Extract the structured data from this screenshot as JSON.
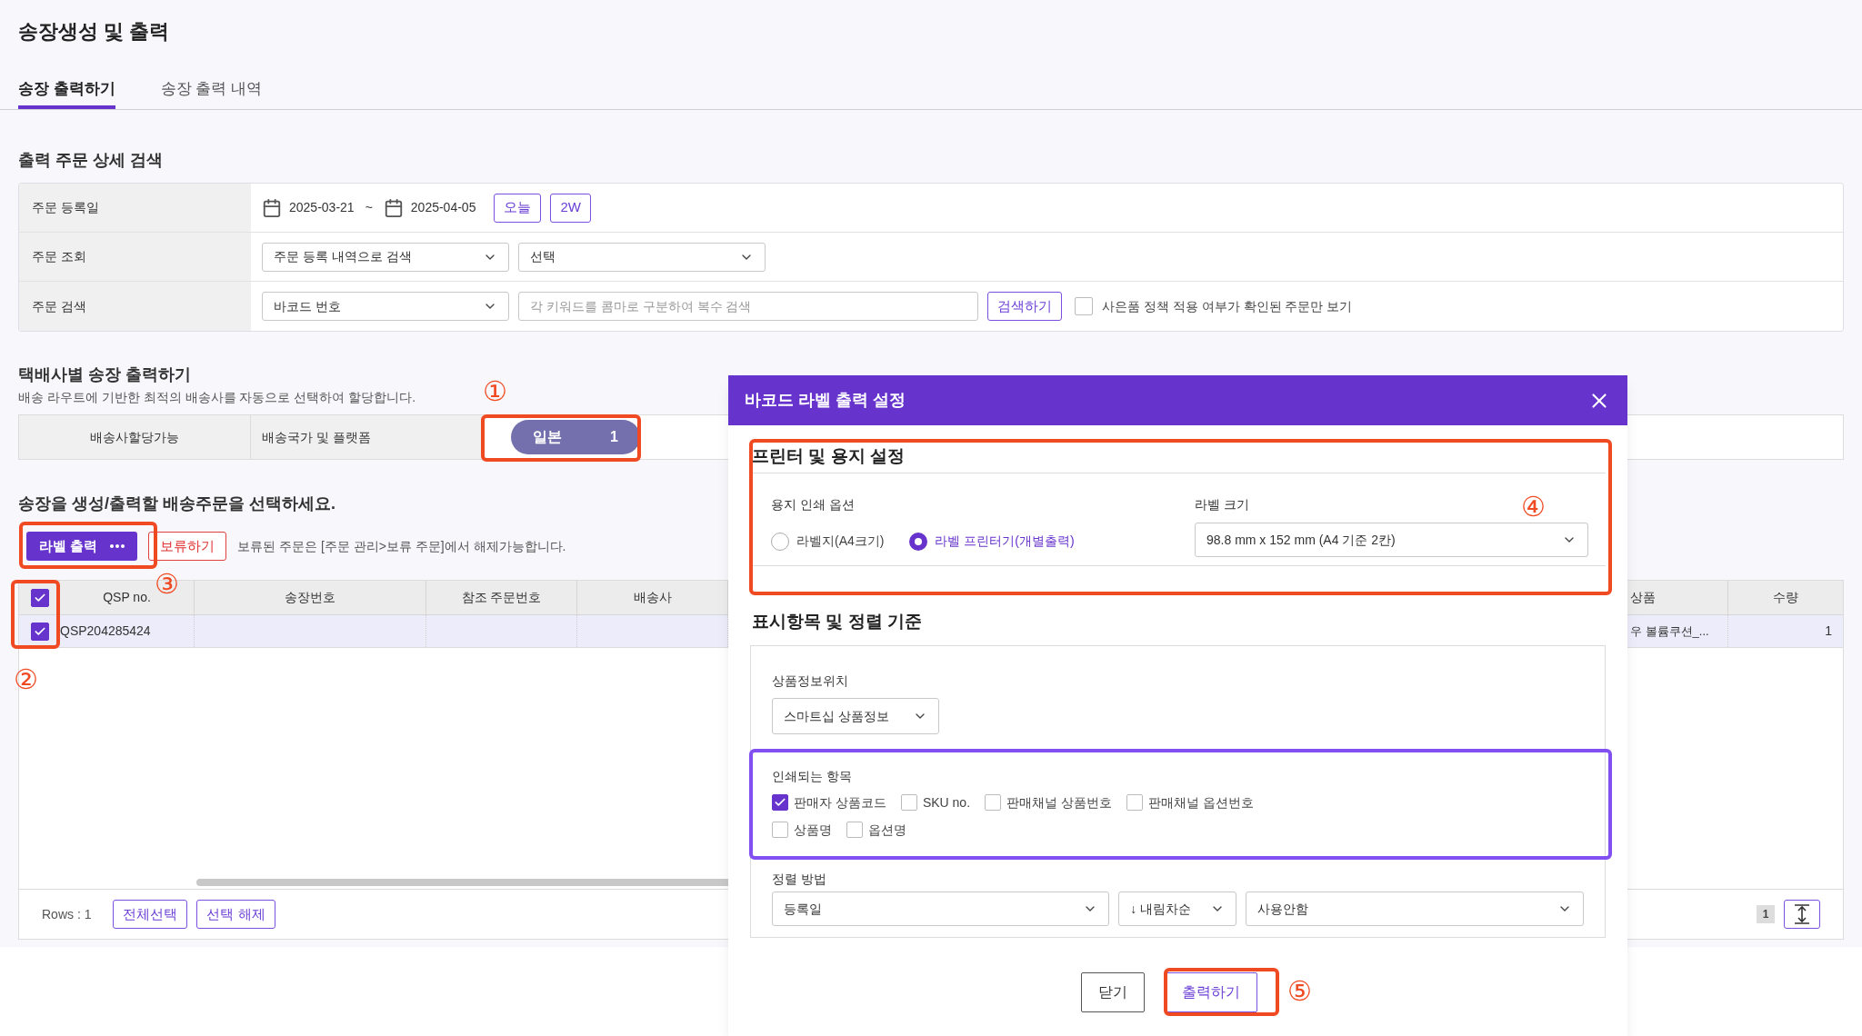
{
  "page_title": "송장생성 및 출력",
  "tabs": [
    {
      "label": "송장 출력하기",
      "selected": true
    },
    {
      "label": "송장 출력 내역",
      "selected": false
    }
  ],
  "search": {
    "title": "출력 주문 상세 검색",
    "date_row": {
      "label": "주문 등록일",
      "start": "2025-03-21",
      "separator": "~",
      "end": "2025-04-05",
      "buttons": [
        "오늘",
        "2W"
      ]
    },
    "query_row": {
      "label": "주문 조회",
      "selects": [
        "주문 등록 내역으로 검색",
        "선택"
      ]
    },
    "keyword_row": {
      "label": "주문 검색",
      "select": "바코드 번호",
      "placeholder": "각 키워드를 콤마로 구분하여 복수 검색",
      "button": "검색하기",
      "filter": {
        "label": "사은품 정책 적용 여부가 확인된 주문만 보기",
        "checked": false
      }
    }
  },
  "carrier": {
    "title": "택배사별 송장 출력하기",
    "subtitle": "배송 라우트에 기반한 최적의 배송사를 자동으로 선택하여 할당합니다.",
    "cells": [
      "배송사할당가능",
      "배송국가 및 플랫폼"
    ],
    "pill": {
      "label": "일본",
      "count": "1"
    }
  },
  "orders": {
    "title": "송장을 생성/출력할 배송주문을 선택하세요.",
    "print_button": "라벨 출력",
    "hold_button": "보류하기",
    "hold_note": "보류된 주문은 [주문 관리>보류 주문]에서 해제가능합니다.",
    "all_checked": true,
    "columns": [
      "QSP no.",
      "송장번호",
      "참조 주문번호",
      "배송사",
      "상품",
      "수량"
    ],
    "rows": [
      {
        "selected": true,
        "checked": true,
        "qsp": "QSP204285424",
        "product": "우 볼륨쿠션_...",
        "qty": "1"
      }
    ],
    "rows_count": "Rows : 1",
    "footer_buttons": [
      "전체선택",
      "선택 해제"
    ],
    "page": "1"
  },
  "modal": {
    "title": "바코드 라벨 출력 설정",
    "printer_section": {
      "title": "프린터 및 용지 설정",
      "paper_label": "용지 인쇄 옵션",
      "options": [
        {
          "label": "라벨지(A4크기)",
          "selected": false
        },
        {
          "label": "라벨 프린터기(개별출력)",
          "selected": true
        }
      ],
      "size_label": "라벨 크기",
      "size_value": "98.8 mm x 152 mm (A4 기준 2칸)"
    },
    "display_section": {
      "title": "표시항목 및 정렬 기준",
      "position_label": "상품정보위치",
      "position_value": "스마트십 상품정보",
      "items_label": "인쇄되는 항목",
      "item_rows": [
        [
          {
            "label": "판매자 상품코드",
            "checked": true
          },
          {
            "label": "SKU no.",
            "checked": false
          },
          {
            "label": "판매채널 상품번호",
            "checked": false
          },
          {
            "label": "판매채널 옵션번호",
            "checked": false
          }
        ],
        [
          {
            "label": "상품명",
            "checked": false
          },
          {
            "label": "옵션명",
            "checked": false
          }
        ]
      ],
      "sort_label": "정렬 방법",
      "sort_values": [
        "등록일",
        "↓ 내림차순",
        "사용안함"
      ]
    },
    "buttons": [
      {
        "label": "닫기",
        "kind": "default"
      },
      {
        "label": "출력하기",
        "kind": "primary"
      }
    ]
  },
  "annotations": [
    "①",
    "②",
    "③",
    "④",
    "⑤"
  ]
}
